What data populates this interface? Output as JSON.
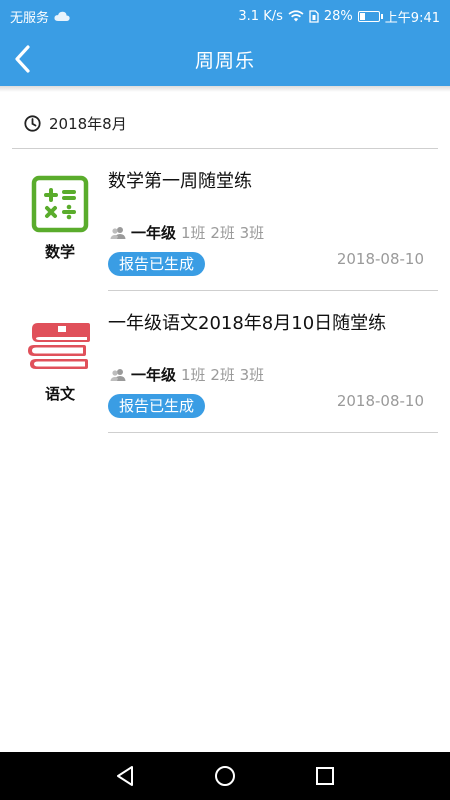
{
  "status_bar": {
    "carrier": "无服务",
    "speed": "3.1 K/s",
    "battery_text": "28%",
    "battery_level": 0.28,
    "time": "上午9:41"
  },
  "header": {
    "title": "周周乐",
    "back_icon": "chevron-left-icon"
  },
  "colors": {
    "primary": "#3a9de4",
    "math_green": "#5aac2c",
    "chinese_red": "#e0505a"
  },
  "date_group": {
    "label": "2018年8月",
    "icon": "clock-icon"
  },
  "items": [
    {
      "subject": "数学",
      "subject_icon": "calculator-icon",
      "title": "数学第一周随堂练",
      "grade": "一年级",
      "classes": "1班 2班 3班",
      "status": "报告已生成",
      "date": "2018-08-10"
    },
    {
      "subject": "语文",
      "subject_icon": "books-icon",
      "title": "一年级语文2018年8月10日随堂练",
      "grade": "一年级",
      "classes": "1班 2班 3班",
      "status": "报告已生成",
      "date": "2018-08-10"
    }
  ],
  "nav": {
    "back": "triangle-back-icon",
    "home": "circle-home-icon",
    "recents": "square-recents-icon"
  }
}
